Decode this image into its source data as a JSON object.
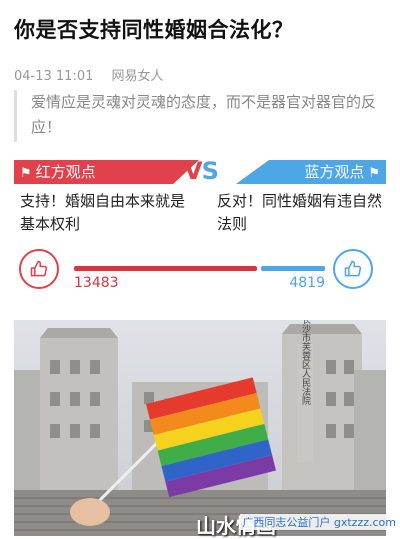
{
  "article": {
    "title": "你是否支持同性婚姻合法化？",
    "date": "04-13 11:01",
    "source": "网易女人",
    "quote": "爱情应是灵魂对灵魂的态度，而不是器官对器官的反应！"
  },
  "debate": {
    "red_label": "红方观点",
    "blue_label": "蓝方观点",
    "vs_v": "V",
    "vs_s": "S",
    "red_opinion": "支持！婚姻自由本来就是基本权利",
    "blue_opinion": "反对！同性婚姻有违自然法则",
    "red_count": "13483",
    "blue_count": "4819",
    "red_fraction": 0.7367,
    "colors": {
      "red": "#e0414a",
      "blue": "#4da6e6"
    },
    "icons": {
      "flag": "flag-icon",
      "like": "thumbs-up-icon"
    }
  },
  "photo": {
    "building_sign": "长沙市芙蓉区人民法院",
    "watermark": "山水情画",
    "site_credit": "广西同志公益门户",
    "site_url": "gxtzzz.com"
  }
}
